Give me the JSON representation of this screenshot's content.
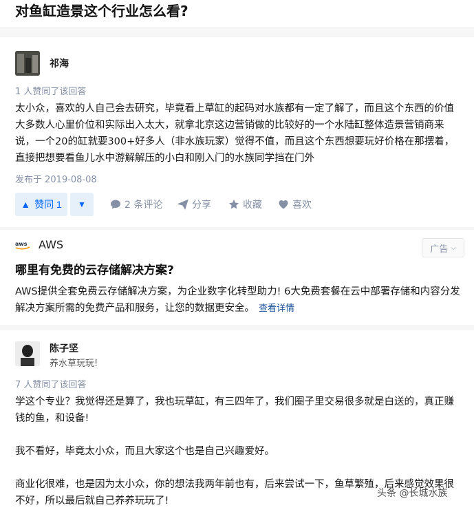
{
  "question": {
    "title": "对鱼缸造景这个行业怎么看?"
  },
  "answer1": {
    "author": "祁海",
    "vote_info": "1 人赞同了该回答",
    "content": "太小众，喜欢的人自己会去研究，毕竟看上草缸的起码对水族都有一定了解了，而且这个东西的价值大多数人心里价位和实际出入太大，就拿北京这边营销做的比较好的一个水陆缸整体造景营销商来说，一个20的缸就要300+好多人（非水族玩家）觉得不值，而且这个东西想要玩好价格在那摆着，直接把想要看鱼儿水中游解解压的小白和刚入门的水族同学挡在门外",
    "published": "发布于 2019-08-08",
    "actions": {
      "upvote": "赞同 1",
      "comments": "2 条评论",
      "share": "分享",
      "favorite": "收藏",
      "like": "喜欢"
    }
  },
  "ad": {
    "brand": "AWS",
    "badge": "广告",
    "title": "哪里有免费的云存储解决方案?",
    "description": "AWS提供全套免费云存储解决方案，为企业数字化转型助力! 6大免费套餐在云中部署存储和内容分发解决方案所需的免费产品和服务，让您的数据更安全。",
    "link": "查看详情"
  },
  "answer2": {
    "author": "陈子坚",
    "bio": "养水草玩玩!",
    "vote_info": "7 人赞同了该回答",
    "paragraphs": [
      "学这个专业？我觉得还是算了，我也玩草缸，有三四年了，我们圈子里交易很多就是白送的，真正赚钱的鱼，和设备!",
      "我不看好，毕竟太小众，而且大家这个也是自己兴趣爱好。",
      "商业化很难，也是因为太小众，你的想法我两年前也有，后来尝试一下，鱼草繁殖，后来感觉效果很不好，所以最后就自己养养玩玩了!"
    ]
  },
  "watermark": "头条 @长城水族",
  "colors": {
    "accent": "#0066ff",
    "muted": "#8590a6",
    "link": "#175199"
  }
}
